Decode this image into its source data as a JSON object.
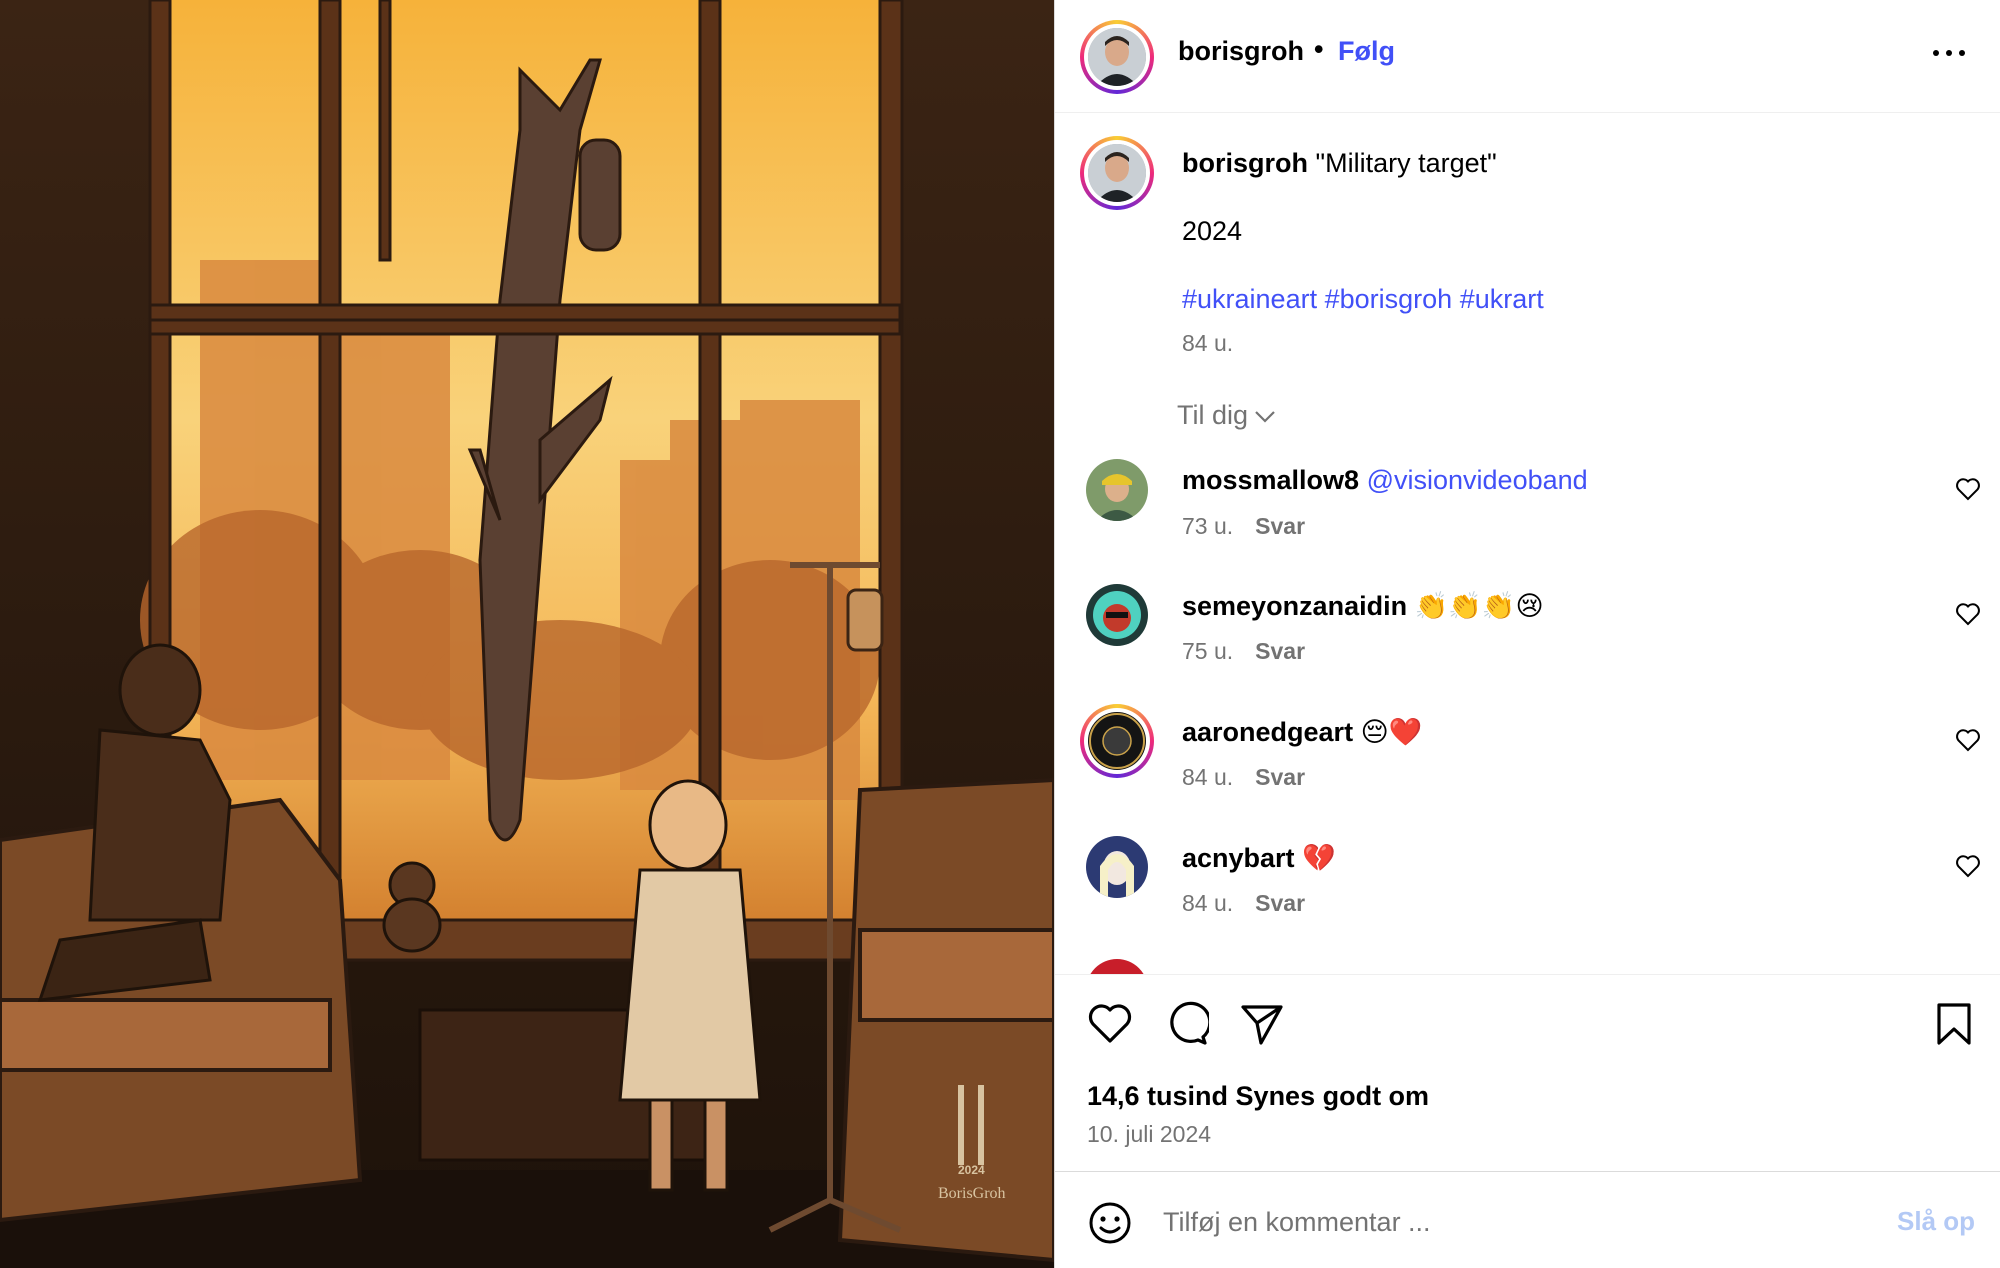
{
  "header": {
    "username": "borisgroh",
    "separator": "•",
    "follow_label": "Følg"
  },
  "caption": {
    "username": "borisgroh",
    "title": "\"Military target\"",
    "year": "2024",
    "hashtags": [
      "#ukraineart",
      "#borisgroh",
      "#ukrart"
    ],
    "time": "84 u."
  },
  "sort": {
    "label": "Til dig"
  },
  "comments": [
    {
      "username": "mossmallow8",
      "text": "",
      "mention": "@visionvideoband",
      "time": "73 u.",
      "reply": "Svar"
    },
    {
      "username": "semeyonzanaidin",
      "text": "👏👏👏😢",
      "mention": "",
      "time": "75 u.",
      "reply": "Svar"
    },
    {
      "username": "aaronedgeart",
      "text": "😔❤️",
      "mention": "",
      "time": "84 u.",
      "reply": "Svar"
    },
    {
      "username": "acnybart",
      "text": "💔",
      "mention": "",
      "time": "84 u.",
      "reply": "Svar"
    }
  ],
  "actions": {
    "likes": "14,6 tusind Synes godt om",
    "date": "10. juli 2024"
  },
  "add_comment": {
    "placeholder": "Tilføj en kommentar ...",
    "post_label": "Slå op"
  },
  "artwork": {
    "signature": "BorisGroh",
    "signature_year": "2024"
  },
  "colors": {
    "link": "#4150f7",
    "muted": "#737373",
    "post_disabled": "#b3c9f5"
  }
}
